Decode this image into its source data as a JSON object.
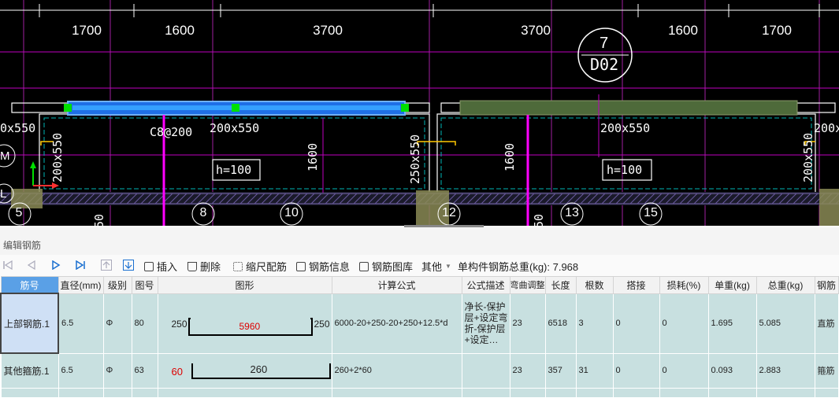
{
  "cad": {
    "dimensions": [
      "1700",
      "1600",
      "3700",
      "3700",
      "1600",
      "1700"
    ],
    "axis_numbers": [
      "5",
      "8",
      "10",
      "12",
      "13",
      "15"
    ],
    "bubble_top": "7",
    "bubble_bottom": "D02",
    "labels": {
      "c1": "C8@200",
      "sec1": "200x550",
      "sec2": "200x550",
      "sec_left": "0x550",
      "sec_right": "200x",
      "h1": "h=100",
      "h2": "h=100",
      "axis_m": "M",
      "axis_l": "L"
    },
    "vertical_labels": {
      "v1": "200x550",
      "v2": "1600",
      "v3": "250x550",
      "v4": "1600",
      "v5": "200x550",
      "v6": "50",
      "v7": "50"
    },
    "colors": {
      "background": "#000000",
      "beam_selected": "#1e90ff",
      "beam_other": "#556b2f",
      "magenta": "#ff00ff",
      "cyan": "#00c8c8"
    }
  },
  "panel": {
    "title": "编辑钢筋",
    "toolbar": {
      "insert": "插入",
      "delete": "删除",
      "scale": "缩尺配筋",
      "info": "钢筋信息",
      "library": "钢筋图库",
      "other": "其他",
      "total": "单构件钢筋总重(kg): 7.968"
    },
    "columns": [
      "筋号",
      "直径(mm)",
      "级别",
      "图号",
      "图形",
      "计算公式",
      "公式描述",
      "弯曲调整",
      "长度",
      "根数",
      "搭接",
      "损耗(%)",
      "单重(kg)",
      "总重(kg)",
      "钢筋"
    ],
    "rows": [
      {
        "name": "上部钢筋.1",
        "diameter": "6.5",
        "grade": "Φ",
        "fig": "80",
        "shape_left": "250",
        "shape_mid": "5960",
        "shape_right": "250",
        "formula": "6000-20+250-20+250+12.5*d",
        "desc": "净长-保护层+设定弯折-保护层+设定…",
        "bend": "23",
        "length": "6518",
        "count": "3",
        "lap": "0",
        "loss": "0",
        "unit_weight": "1.695",
        "total_weight": "5.085",
        "type": "直筋"
      },
      {
        "name": "其他箍筋.1",
        "diameter": "6.5",
        "grade": "Φ",
        "fig": "63",
        "shape_left": "60",
        "shape_mid": "260",
        "formula": "260+2*60",
        "desc": "",
        "bend": "23",
        "length": "357",
        "count": "31",
        "lap": "0",
        "loss": "0",
        "unit_weight": "0.093",
        "total_weight": "2.883",
        "type": "箍筋"
      }
    ]
  }
}
